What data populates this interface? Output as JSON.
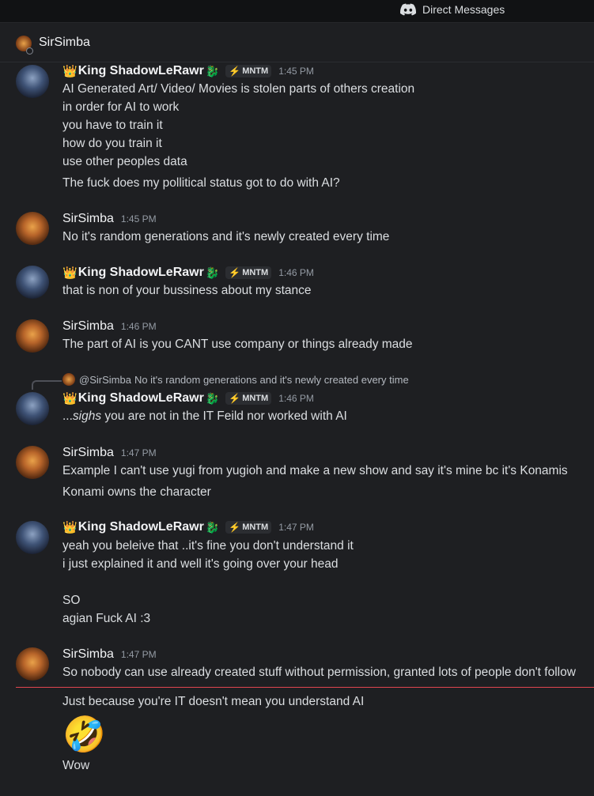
{
  "topbar": {
    "title": "Direct Messages"
  },
  "channel": {
    "name": "SirSimba"
  },
  "messages": [
    {
      "author": "King ShadowLeRawr",
      "crown": "👑",
      "dragon": "🐉",
      "tag": "MNTM",
      "tag_icon": "⚡",
      "time": "1:45 PM",
      "lines": [
        "AI Generated Art/ Video/ Movies is stolen parts of others creation",
        "in order for AI to work",
        "you have to train it",
        "how do you train it",
        "use other peoples data",
        "The fuck does my pollitical status got to do with AI?"
      ]
    },
    {
      "author": "SirSimba",
      "time": "1:45 PM",
      "lines": [
        "No it's random generations and it's newly created every time"
      ]
    },
    {
      "author": "King ShadowLeRawr",
      "crown": "👑",
      "dragon": "🐉",
      "tag": "MNTM",
      "tag_icon": "⚡",
      "time": "1:46 PM",
      "lines": [
        "that is non of your bussiness about my stance"
      ]
    },
    {
      "author": "SirSimba",
      "time": "1:46 PM",
      "lines": [
        "The part of AI is you CANT use company or things already made"
      ]
    },
    {
      "reply_to": {
        "name": "@SirSimba",
        "text": "No it's random generations and it's newly created every time"
      },
      "author": "King ShadowLeRawr",
      "crown": "👑",
      "dragon": "🐉",
      "tag": "MNTM",
      "tag_icon": "⚡",
      "time": "1:46 PM",
      "line_prefix": "...",
      "line_em": "sighs",
      "line_rest": " you are not in the IT Feild nor worked with AI"
    },
    {
      "author": "SirSimba",
      "time": "1:47 PM",
      "lines": [
        "Example I can't use yugi from yugioh and make a new show and say it's mine bc it's Konamis",
        "Konami owns the character"
      ]
    },
    {
      "author": "King ShadowLeRawr",
      "crown": "👑",
      "dragon": "🐉",
      "tag": "MNTM",
      "tag_icon": "⚡",
      "time": "1:47 PM",
      "lines": [
        "yeah you beleive that ..it's fine you don't understand it",
        "i just explained it and well it's going over your head",
        "SO",
        "agian Fuck AI :3"
      ]
    },
    {
      "author": "SirSimba",
      "time": "1:47 PM",
      "lines": [
        "So nobody can use already created stuff without permission, granted lots of people don't follow",
        "Just because you're IT doesn't mean you understand AI",
        "Wow"
      ],
      "emoji": "🤣"
    }
  ]
}
